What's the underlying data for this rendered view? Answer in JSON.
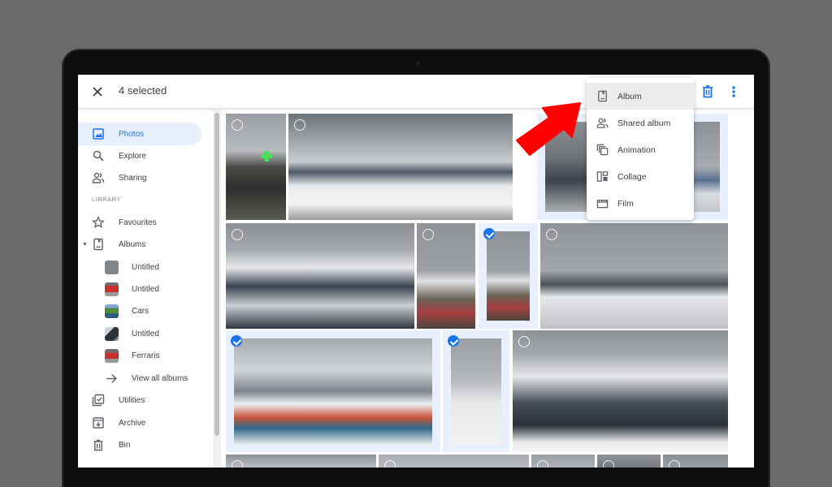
{
  "header": {
    "selection_count_label": "4 selected",
    "close_icon": "close-icon",
    "trash_icon": "trash-icon",
    "more_icon": "more-vert-icon",
    "accent_color": "#1a73e8"
  },
  "sidebar": {
    "items": [
      {
        "label": "Photos",
        "icon": "photo-icon",
        "active": true
      },
      {
        "label": "Explore",
        "icon": "search-icon"
      },
      {
        "label": "Sharing",
        "icon": "people-icon"
      }
    ],
    "library_label": "LIBRARY",
    "library_items": [
      {
        "label": "Favourites",
        "icon": "star-icon"
      },
      {
        "label": "Albums",
        "icon": "album-icon",
        "expanded": true
      }
    ],
    "albums": [
      {
        "label": "Untitled",
        "thumb": "gray"
      },
      {
        "label": "Untitled",
        "thumb": "red-car"
      },
      {
        "label": "Cars",
        "thumb": "green-car"
      },
      {
        "label": "Untitled",
        "thumb": "dark-car"
      },
      {
        "label": "Ferraris",
        "thumb": "red-car"
      }
    ],
    "view_all_label": "View all albums",
    "bottom_items": [
      {
        "label": "Utilities",
        "icon": "utilities-icon"
      },
      {
        "label": "Archive",
        "icon": "archive-icon"
      },
      {
        "label": "Bin",
        "icon": "bin-icon"
      }
    ]
  },
  "create_menu": {
    "items": [
      {
        "label": "Album",
        "icon": "album-icon",
        "highlighted": true
      },
      {
        "label": "Shared album",
        "icon": "people-icon"
      },
      {
        "label": "Animation",
        "icon": "animation-icon"
      },
      {
        "label": "Collage",
        "icon": "collage-icon"
      },
      {
        "label": "Film",
        "icon": "film-icon"
      }
    ]
  },
  "photos": [
    {
      "desc": "street-pharmacy",
      "selected": false
    },
    {
      "desc": "panorama-snow",
      "selected": false
    },
    {
      "desc": "mountain-right-partial",
      "selected": false
    },
    {
      "desc": "mountain-far-right",
      "selected": false
    },
    {
      "desc": "cable-car-mountains",
      "selected": false
    },
    {
      "desc": "ski-hut",
      "selected": false
    },
    {
      "desc": "ski-hut-crop",
      "selected": true
    },
    {
      "desc": "cloudy-peaks",
      "selected": false
    },
    {
      "desc": "ski-terrace-crowd",
      "selected": true
    },
    {
      "desc": "chairlift",
      "selected": true
    },
    {
      "desc": "glacier-valley",
      "selected": false
    },
    {
      "desc": "bottom-1",
      "selected": false
    },
    {
      "desc": "bottom-2",
      "selected": false
    },
    {
      "desc": "bottom-3",
      "selected": false
    },
    {
      "desc": "bottom-4",
      "selected": false
    },
    {
      "desc": "bottom-5",
      "selected": false
    }
  ],
  "annotation": {
    "type": "red-arrow",
    "points_to": "Album",
    "color": "#ff0000"
  }
}
